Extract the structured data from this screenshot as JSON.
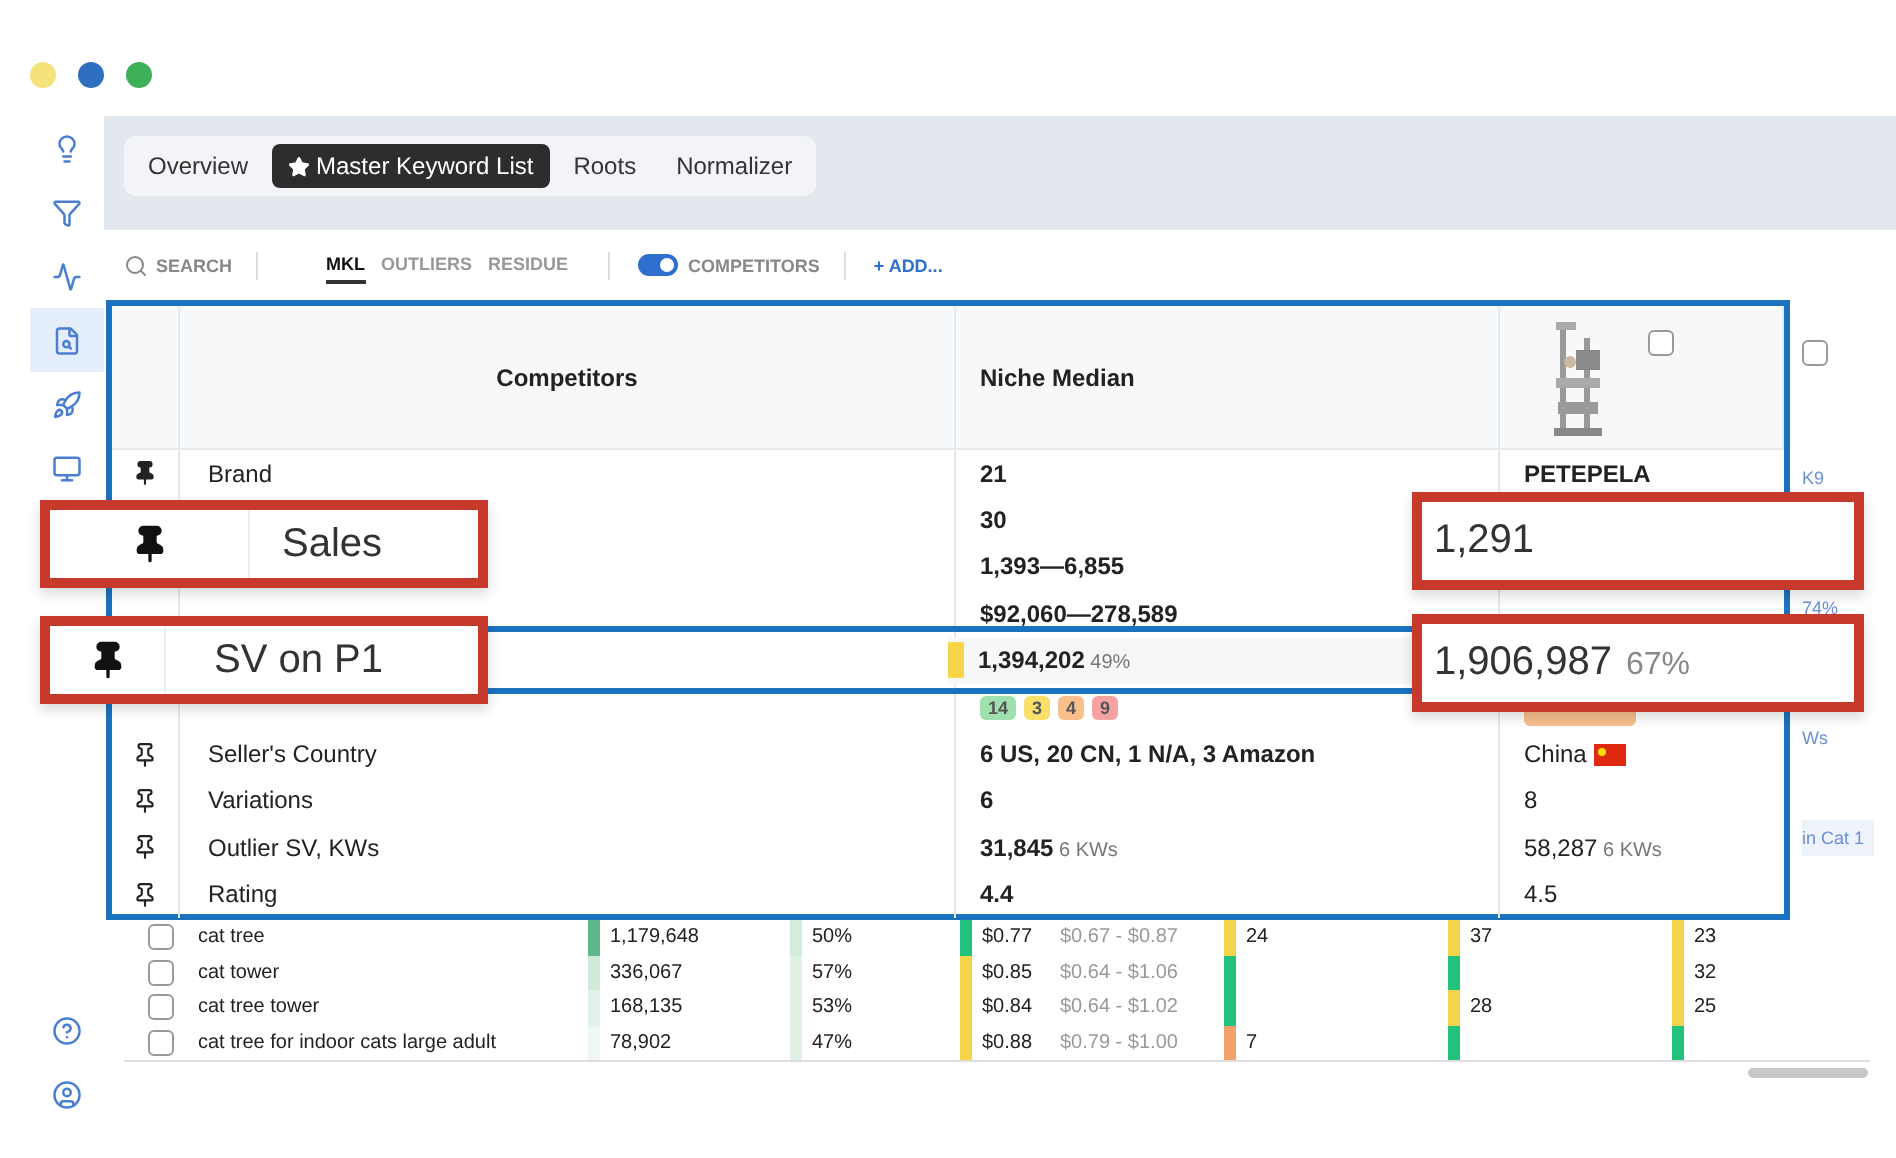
{
  "sidebar": {
    "items": [
      {
        "kind": "bulb",
        "selected": false
      },
      {
        "kind": "filter",
        "selected": false
      },
      {
        "kind": "pulse",
        "selected": false
      },
      {
        "kind": "search-doc",
        "selected": true
      },
      {
        "kind": "rocket",
        "selected": false
      },
      {
        "kind": "monitor",
        "selected": false
      }
    ],
    "bottom": [
      {
        "kind": "help",
        "selected": false
      },
      {
        "kind": "user",
        "selected": false
      }
    ]
  },
  "tabs": [
    {
      "label": "Overview",
      "selected": false,
      "starred": false
    },
    {
      "label": "Master Keyword List",
      "selected": true,
      "starred": true
    },
    {
      "label": "Roots",
      "selected": false,
      "starred": false
    },
    {
      "label": "Normalizer",
      "selected": false,
      "starred": false
    }
  ],
  "toolbar": {
    "search": "SEARCH",
    "views": [
      {
        "label": "MKL",
        "selected": true
      },
      {
        "label": "OUTLIERS",
        "selected": false
      },
      {
        "label": "RESIDUE",
        "selected": false
      }
    ],
    "competitors_toggle": {
      "label": "COMPETITORS",
      "on": true
    },
    "add": "+ ADD..."
  },
  "competitors_table": {
    "columns": [
      "Competitors",
      "Niche Median"
    ],
    "competitor": {
      "checked": false
    },
    "rows": [
      {
        "label": "Brand",
        "pinned": true,
        "median": "21",
        "value": "PETEPELA",
        "kind": "text"
      },
      {
        "median": "30",
        "kind": "text"
      },
      {
        "median": "1,393—6,855",
        "kind": "text"
      },
      {
        "median": "$92,060—278,589",
        "kind": "text"
      },
      {
        "median": "1,394,202",
        "median_note": "49%",
        "kind": "highlight"
      },
      {
        "badges": [
          {
            "text": "14",
            "color": "#9fe0ae"
          },
          {
            "text": "3",
            "color": "#f9e06a"
          },
          {
            "text": "4",
            "color": "#f9c08c"
          },
          {
            "text": "9",
            "color": "#f4a3a0"
          }
        ],
        "value_badge": {
          "color": "#f9c08c"
        },
        "kind": "badges"
      },
      {
        "label": "Seller's Country",
        "pinned": false,
        "median": "6 US, 20 CN, 1 N/A, 3 Amazon",
        "value": "China",
        "flag": true,
        "kind": "text"
      },
      {
        "label": "Variations",
        "pinned": false,
        "median": "6",
        "value": "8",
        "kind": "text"
      },
      {
        "label": "Outlier SV, KWs",
        "pinned": false,
        "median": "31,845",
        "median_note": "6 KWs",
        "value": "58,287",
        "value_note": "6 KWs",
        "kind": "text"
      },
      {
        "label": "Rating",
        "pinned": false,
        "median": "4.4",
        "value": "4.5",
        "kind": "text"
      }
    ],
    "next_column": {
      "checked": false,
      "texts": [
        "K9",
        "74%",
        "Ws",
        "in Cat 1"
      ]
    }
  },
  "callouts": [
    {
      "label": "Sales",
      "pinned": true,
      "value": "1,291"
    },
    {
      "label": "SV on P1",
      "pinned": true,
      "value": "1,906,987",
      "note": "67%"
    }
  ],
  "keywords": [
    {
      "checked": false,
      "keyword": "cat tree",
      "cells": [
        {
          "kind": "bar",
          "text": "1,179,648",
          "color": "#5cb88a"
        },
        {
          "kind": "bar",
          "text": "50%",
          "color": "#d3ecdc"
        },
        {
          "kind": "bar",
          "text": "$0.77",
          "color": "#22c27f"
        },
        {
          "kind": "plain",
          "text": "$0.67 - $0.87"
        },
        {
          "kind": "bar",
          "text": "24",
          "color": "#f7d54a"
        },
        {
          "kind": "bar",
          "text": "37",
          "color": "#f7d54a"
        },
        {
          "kind": "bar",
          "text": "23",
          "color": "#f7d54a"
        }
      ]
    },
    {
      "checked": false,
      "keyword": "cat tower",
      "cells": [
        {
          "kind": "bar",
          "text": "336,067",
          "color": "#cfe9da"
        },
        {
          "kind": "bar",
          "text": "57%",
          "color": "#e0f1e6"
        },
        {
          "kind": "bar",
          "text": "$0.85",
          "color": "#f7d54a"
        },
        {
          "kind": "plain",
          "text": "$0.64 - $1.06"
        },
        {
          "kind": "bar",
          "color": "#22c27f"
        },
        {
          "kind": "bar",
          "color": "#22c27f"
        },
        {
          "kind": "bar",
          "text": "32",
          "color": "#f7d54a"
        }
      ]
    },
    {
      "checked": false,
      "keyword": "cat tree tower",
      "cells": [
        {
          "kind": "bar",
          "text": "168,135",
          "color": "#e3f2e8"
        },
        {
          "kind": "bar",
          "text": "53%",
          "color": "#e0f1e6"
        },
        {
          "kind": "bar",
          "text": "$0.84",
          "color": "#f7d54a"
        },
        {
          "kind": "plain",
          "text": "$0.64 - $1.02"
        },
        {
          "kind": "bar",
          "color": "#22c27f"
        },
        {
          "kind": "bar",
          "text": "28",
          "color": "#f7d54a"
        },
        {
          "kind": "bar",
          "text": "25",
          "color": "#f7d54a"
        }
      ]
    },
    {
      "checked": false,
      "keyword": "cat tree for indoor cats large adult",
      "cells": [
        {
          "kind": "bar",
          "text": "78,902",
          "color": "#eef7f1"
        },
        {
          "kind": "bar",
          "text": "47%",
          "color": "#e0f1e6"
        },
        {
          "kind": "bar",
          "text": "$0.88",
          "color": "#f7d54a"
        },
        {
          "kind": "plain",
          "text": "$0.79 - $1.00"
        },
        {
          "kind": "bar",
          "text": "7",
          "color": "#f5a06a"
        },
        {
          "kind": "bar",
          "color": "#22c27f"
        },
        {
          "kind": "bar",
          "color": "#22c27f"
        }
      ]
    }
  ]
}
